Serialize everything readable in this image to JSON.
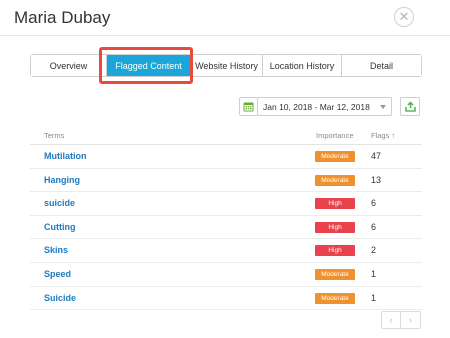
{
  "header": {
    "title": "Maria Dubay",
    "close_glyph": "✕"
  },
  "tabs": [
    {
      "label": "Overview",
      "active": false
    },
    {
      "label": "Flagged Content",
      "active": true
    },
    {
      "label": "Website History",
      "active": false
    },
    {
      "label": "Location History",
      "active": false
    },
    {
      "label": "Detail",
      "active": false
    }
  ],
  "toolbar": {
    "date_range": "Jan 10, 2018 - Mar 12, 2018",
    "calendar_icon": "calendar-icon",
    "export_icon": "export-icon",
    "accent_color": "#5cb85c"
  },
  "table": {
    "headers": {
      "terms": "Terms",
      "importance": "Importance",
      "flags": "Flags ↑"
    },
    "rows": [
      {
        "term": "Mutilation",
        "importance": "Moderate",
        "flags": "47"
      },
      {
        "term": "Hanging",
        "importance": "Moderate",
        "flags": "13"
      },
      {
        "term": "suicide",
        "importance": "High",
        "flags": "6"
      },
      {
        "term": "Cutting",
        "importance": "High",
        "flags": "6"
      },
      {
        "term": "Skins",
        "importance": "High",
        "flags": "2"
      },
      {
        "term": "Speed",
        "importance": "Moderate",
        "flags": "1"
      },
      {
        "term": "Suicide",
        "importance": "Moderate",
        "flags": "1"
      }
    ]
  },
  "colors": {
    "moderate": "#f0912f",
    "high": "#e8424d",
    "active_tab": "#1aa6d8",
    "link": "#1e7bbf",
    "highlight": "#e84b3c"
  },
  "pager": {
    "prev": "‹",
    "next": "›"
  }
}
